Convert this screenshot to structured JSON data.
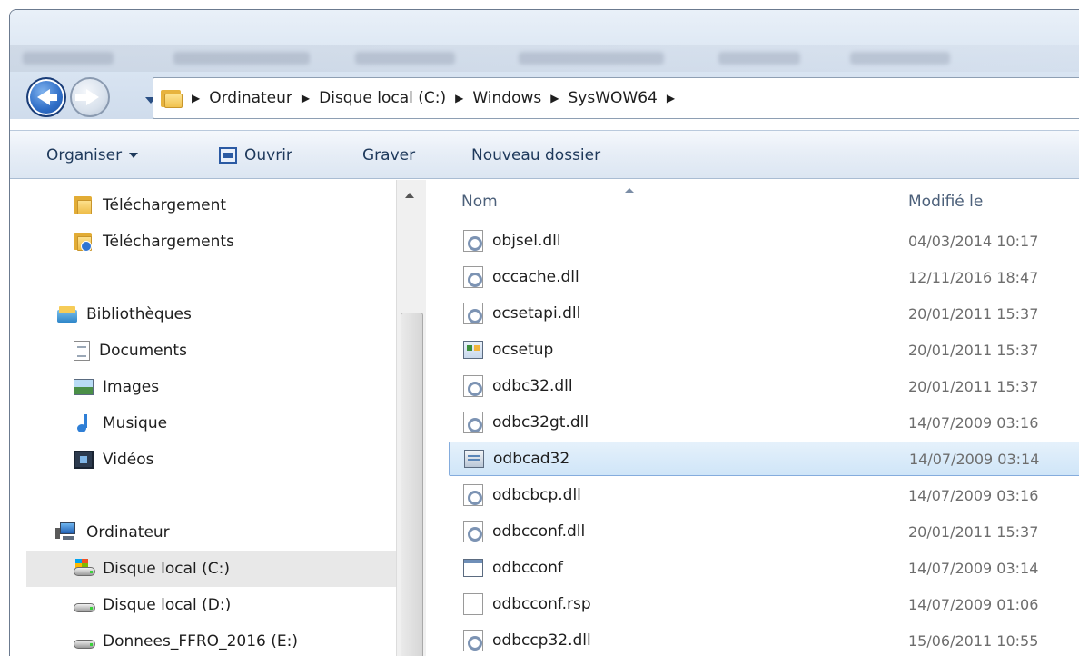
{
  "address_bar": {
    "crumbs": [
      "Ordinateur",
      "Disque local (C:)",
      "Windows",
      "SysWOW64"
    ]
  },
  "command_bar": {
    "organize": "Organiser",
    "open": "Ouvrir",
    "burn": "Graver",
    "new_folder": "Nouveau dossier"
  },
  "nav_pane": {
    "items": [
      {
        "label": "Téléchargement",
        "icon": "folder-icon"
      },
      {
        "label": "Téléchargements",
        "icon": "downloads-folder-icon"
      },
      {
        "label": "Bibliothèques",
        "icon": "libraries-icon"
      },
      {
        "label": "Documents",
        "icon": "documents-icon"
      },
      {
        "label": "Images",
        "icon": "pictures-icon"
      },
      {
        "label": "Musique",
        "icon": "music-icon"
      },
      {
        "label": "Vidéos",
        "icon": "videos-icon"
      },
      {
        "label": "Ordinateur",
        "icon": "computer-icon"
      },
      {
        "label": "Disque local (C:)",
        "icon": "system-drive-icon",
        "selected": true
      },
      {
        "label": "Disque local (D:)",
        "icon": "drive-icon"
      },
      {
        "label": "Donnees_FFRO_2016 (E:)",
        "icon": "drive-icon"
      }
    ]
  },
  "file_list": {
    "columns": {
      "name": "Nom",
      "modified": "Modifié le"
    },
    "files": [
      {
        "name": "objsel.dll",
        "modified": "04/03/2014 10:17",
        "icon": "dll-file-icon"
      },
      {
        "name": "occache.dll",
        "modified": "12/11/2016 18:47",
        "icon": "dll-file-icon"
      },
      {
        "name": "ocsetapi.dll",
        "modified": "20/01/2011 15:37",
        "icon": "dll-file-icon"
      },
      {
        "name": "ocsetup",
        "modified": "20/01/2011 15:37",
        "icon": "setup-app-icon"
      },
      {
        "name": "odbc32.dll",
        "modified": "20/01/2011 15:37",
        "icon": "dll-file-icon"
      },
      {
        "name": "odbc32gt.dll",
        "modified": "14/07/2009 03:16",
        "icon": "dll-file-icon"
      },
      {
        "name": "odbcad32",
        "modified": "14/07/2009 03:14",
        "icon": "odbc-admin-app-icon",
        "selected": true
      },
      {
        "name": "odbcbcp.dll",
        "modified": "14/07/2009 03:16",
        "icon": "dll-file-icon"
      },
      {
        "name": "odbcconf.dll",
        "modified": "20/01/2011 15:37",
        "icon": "dll-file-icon"
      },
      {
        "name": "odbcconf",
        "modified": "14/07/2009 03:14",
        "icon": "console-app-icon"
      },
      {
        "name": "odbcconf.rsp",
        "modified": "14/07/2009 01:06",
        "icon": "blank-file-icon"
      },
      {
        "name": "odbccp32.dll",
        "modified": "15/06/2011 10:55",
        "icon": "dll-file-icon"
      }
    ]
  }
}
